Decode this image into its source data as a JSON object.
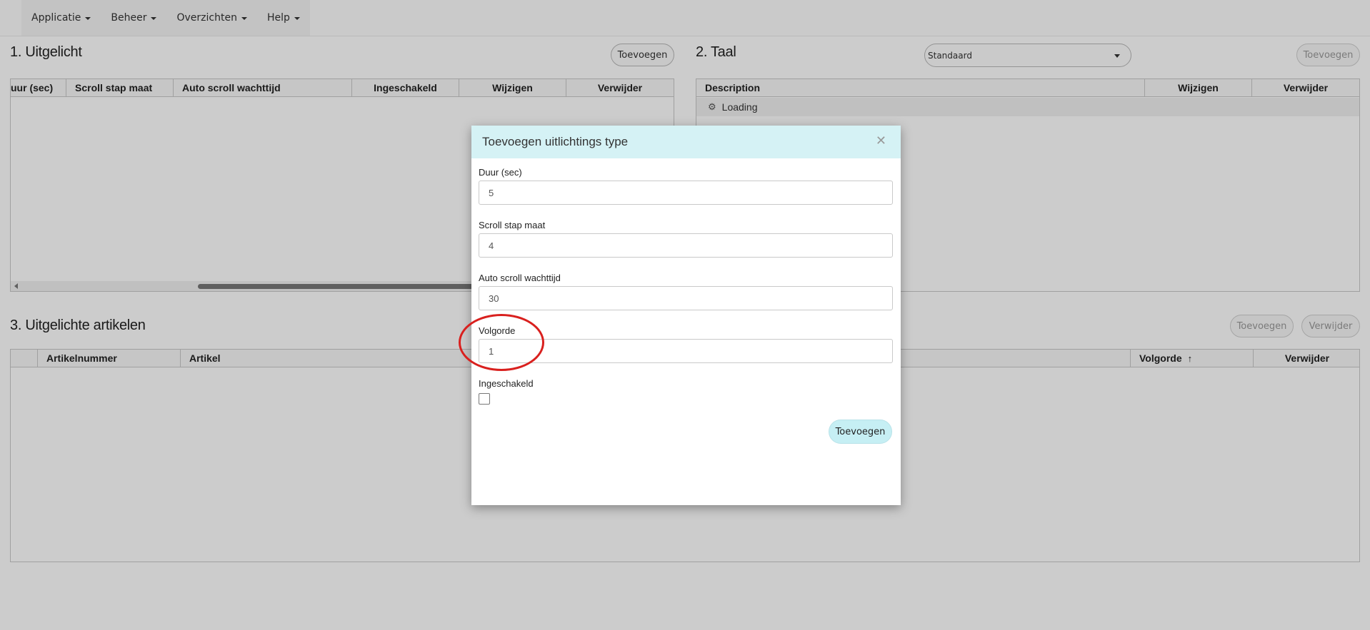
{
  "nav": {
    "items": [
      {
        "label": "Applicatie"
      },
      {
        "label": "Beheer"
      },
      {
        "label": "Overzichten"
      },
      {
        "label": "Help"
      }
    ]
  },
  "section1": {
    "title": "1. Uitgelicht",
    "add_label": "Toevoegen",
    "columns": [
      "uur (sec)",
      "Scroll stap maat",
      "Auto scroll wachttijd",
      "Ingeschakeld",
      "Wijzigen",
      "Verwijder"
    ]
  },
  "section2": {
    "title": "2. Taal",
    "select_value": "Standaard",
    "add_label": "Toevoegen",
    "columns": [
      "Description",
      "Wijzigen",
      "Verwijder"
    ],
    "loading_text": "Loading"
  },
  "section3": {
    "title": "3. Uitgelichte artikelen",
    "add_label": "Toevoegen",
    "delete_label": "Verwijder",
    "columns": [
      "",
      "Artikelnummer",
      "Artikel",
      "Volgorde",
      "Verwijder"
    ]
  },
  "modal": {
    "title": "Toevoegen uitlichtings type",
    "fields": [
      {
        "label": "Duur (sec)",
        "value": "5"
      },
      {
        "label": "Scroll stap maat",
        "value": "4"
      },
      {
        "label": "Auto scroll wachttijd",
        "value": "30"
      },
      {
        "label": "Volgorde",
        "value": "1"
      }
    ],
    "checkbox_label": "Ingeschakeld",
    "checkbox_checked": false,
    "submit_label": "Toevoegen"
  },
  "colors": {
    "modal_header": "#d5f2f5",
    "submit_button": "#c6eff4",
    "annotation": "#d9201e",
    "overlay": "rgba(0,0,0,0.2)"
  },
  "icons": [
    "caret-down-icon",
    "gear-icon",
    "close-icon",
    "sort-up-icon"
  ]
}
